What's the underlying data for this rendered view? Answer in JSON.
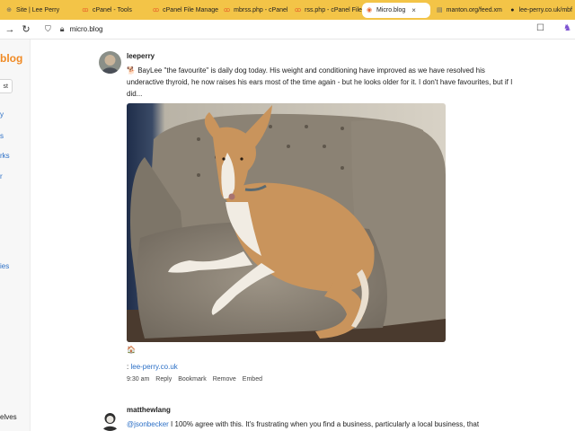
{
  "tabs": [
    {
      "title": "Site | Lee Perry",
      "icon": "globe-icon",
      "active": false
    },
    {
      "title": "cPanel - Tools",
      "icon": "cpanel-icon",
      "active": false
    },
    {
      "title": "cPanel File Manage",
      "icon": "cpanel-icon",
      "active": false
    },
    {
      "title": "mbrss.php - cPanel",
      "icon": "cpanel-icon",
      "active": false
    },
    {
      "title": "rss.php - cPanel File",
      "icon": "cpanel-icon",
      "active": false
    },
    {
      "title": "Micro.blog",
      "icon": "microblog-icon",
      "active": true
    },
    {
      "title": "manton.org/feed.xm",
      "icon": "document-icon",
      "active": false
    },
    {
      "title": "lee-perry.co.uk/mbf",
      "icon": "github-icon",
      "active": false
    }
  ],
  "address": {
    "url": "micro.blog"
  },
  "sidebar": {
    "logo": "blog",
    "button": "st",
    "items": [
      "y",
      "s",
      "rks",
      "r",
      "ies",
      "elves"
    ]
  },
  "posts": [
    {
      "username": "leeperry",
      "emoji": "🐕",
      "text": "BayLee \"the favourite\" is daily dog today. His weight and conditioning have improved as we have resolved his underactive thyroid, he now raises his ears most of the time again - but he looks older for it. I don't have favourites, but if I did...",
      "photo_alt": "dog on sofa",
      "small_emoji": "🏠",
      "link_prefix": ":",
      "link": "lee-perry.co.uk",
      "time": "9:30 am",
      "actions": [
        "Reply",
        "Bookmark",
        "Remove",
        "Embed"
      ]
    },
    {
      "username": "matthewlang",
      "mention": "@jsonbecker",
      "text": "I 100% agree with this. It's frustrating when you find a business, particularly a local business, that"
    }
  ]
}
